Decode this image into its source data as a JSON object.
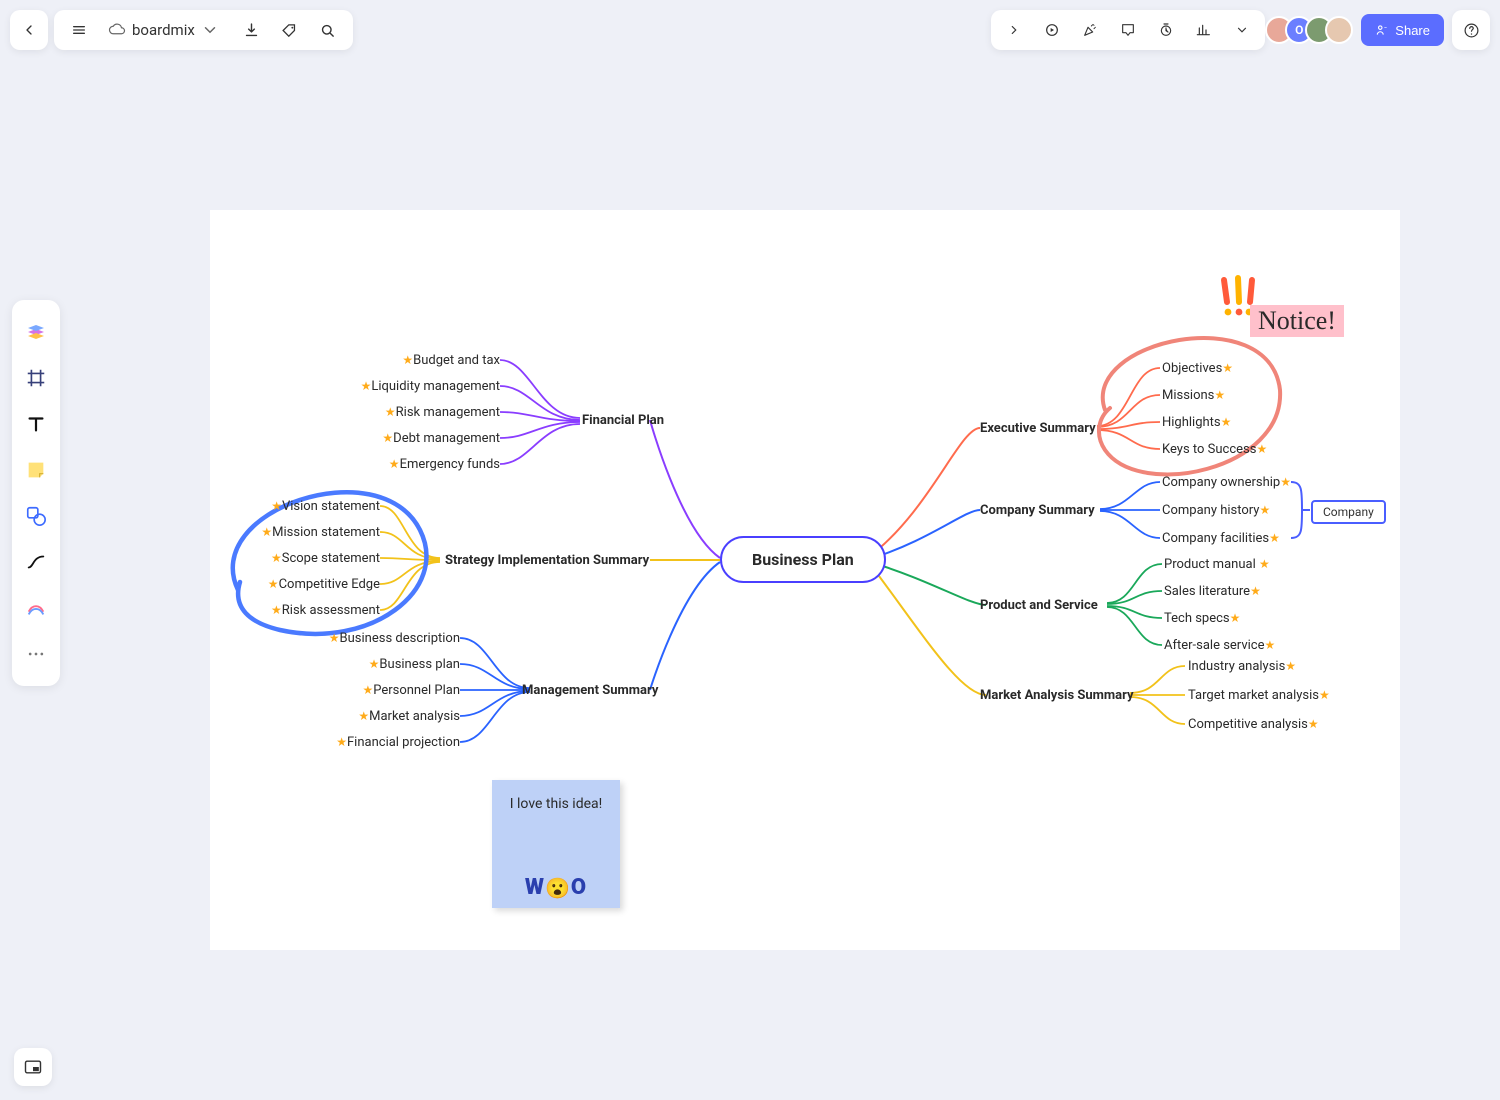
{
  "app": {
    "name": "boardmix"
  },
  "share": {
    "label": "Share"
  },
  "notice": {
    "text": "Notice!"
  },
  "centerNode": "Business Plan",
  "companyTag": "Company",
  "sticky": {
    "text": "I love this idea!",
    "woo_left": "W",
    "woo_mid": "😮",
    "woo_right": "O"
  },
  "branches": {
    "left": [
      {
        "title": "Financial Plan",
        "leaves": [
          "Budget and tax",
          "Liquidity management",
          "Risk management",
          "Debt management",
          "Emergency funds"
        ]
      },
      {
        "title": "Strategy Implementation Summary",
        "leaves": [
          "Vision statement",
          "Mission statement",
          "Scope statement",
          "Competitive Edge",
          "Risk assessment"
        ]
      },
      {
        "title": "Management Summary",
        "leaves": [
          "Business description",
          "Business plan",
          "Personnel Plan",
          "Market analysis",
          "Financial  projection"
        ]
      }
    ],
    "right": [
      {
        "title": "Executive Summary",
        "leaves": [
          "Objectives",
          "Missions",
          "Highlights",
          "Keys to Success"
        ]
      },
      {
        "title": "Company Summary",
        "leaves": [
          "Company ownership",
          "Company history",
          "Company facilities"
        ]
      },
      {
        "title": "Product and Service",
        "leaves": [
          "Product manual",
          "Sales literature",
          "Tech specs",
          "After-sale service"
        ]
      },
      {
        "title": "Market Analysis Summary",
        "leaves": [
          "Industry analysis",
          "Target market analysis",
          "Competitive analysis"
        ]
      }
    ]
  }
}
